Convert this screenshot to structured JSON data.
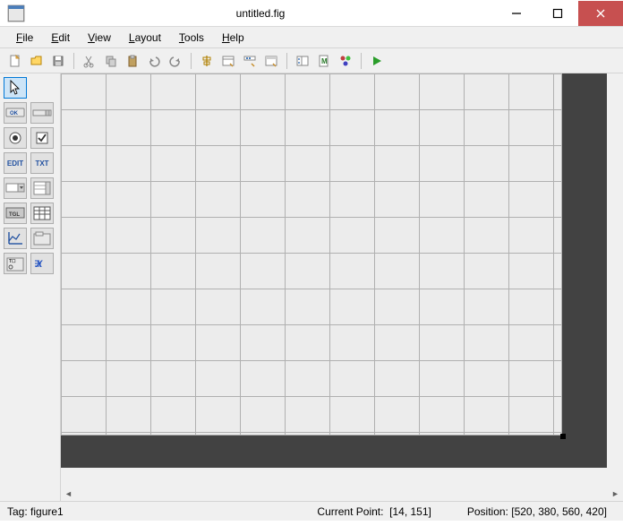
{
  "window": {
    "title": "untitled.fig"
  },
  "menu": {
    "items": [
      {
        "label": "File",
        "accel": "F"
      },
      {
        "label": "Edit",
        "accel": "E"
      },
      {
        "label": "View",
        "accel": "V"
      },
      {
        "label": "Layout",
        "accel": "L"
      },
      {
        "label": "Tools",
        "accel": "T"
      },
      {
        "label": "Help",
        "accel": "H"
      }
    ]
  },
  "toolbar": {
    "buttons": [
      "new-file",
      "open-file",
      "save-file",
      "sep",
      "cut",
      "copy",
      "paste",
      "undo",
      "redo",
      "sep",
      "align-objects",
      "menu-editor",
      "toolbar-editor",
      "property-inspector",
      "sep",
      "object-browser",
      "m-file-editor",
      "gui-options",
      "sep",
      "run-figure"
    ]
  },
  "palette": {
    "rows": [
      [
        "select-tool"
      ],
      [
        "push-button",
        "slider"
      ],
      [
        "radio-button",
        "check-box"
      ],
      [
        "edit-text",
        "static-text"
      ],
      [
        "popup-menu",
        "listbox"
      ],
      [
        "toggle-button",
        "table"
      ],
      [
        "axes",
        "panel"
      ],
      [
        "button-group",
        "activex"
      ]
    ],
    "selected": "select-tool"
  },
  "status": {
    "tag_label": "Tag:",
    "tag_value": "figure1",
    "cp_label": "Current Point:",
    "cp_value": "[14, 151]",
    "pos_label": "Position:",
    "pos_value": "[520, 380, 560, 420]"
  }
}
